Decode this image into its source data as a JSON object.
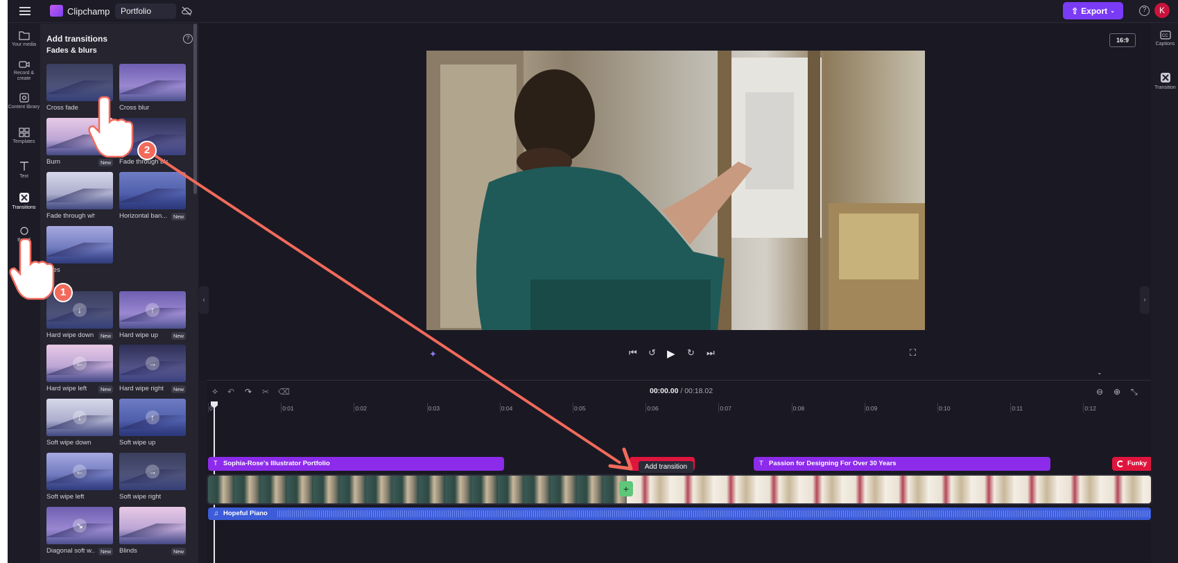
{
  "app": {
    "name": "Clipchamp",
    "project_name": "Portfolio",
    "export_label": "Export",
    "avatar_initial": "K",
    "accent_color": "#7a3bf5"
  },
  "left_rail": {
    "items": [
      {
        "label": "Your media",
        "icon": "folder-icon"
      },
      {
        "label": "Record & create",
        "icon": "camera-icon"
      },
      {
        "label": "Content library",
        "icon": "library-icon"
      },
      {
        "label": "Templates",
        "icon": "templates-icon"
      },
      {
        "label": "Text",
        "icon": "text-icon"
      },
      {
        "label": "Transitions",
        "icon": "transitions-icon",
        "active": true
      },
      {
        "label": "Brand",
        "icon": "brand-icon"
      }
    ]
  },
  "panel": {
    "title": "Add transitions",
    "section": "Fades & blurs",
    "tiles": [
      {
        "label": "Cross fade",
        "new": false
      },
      {
        "label": "Cross blur",
        "new": false
      },
      {
        "label": "Burn",
        "new": true
      },
      {
        "label": "Fade through black",
        "new": false
      },
      {
        "label": "Fade through white",
        "new": false
      },
      {
        "label": "Horizontal ban...",
        "new": true
      },
      {
        "label": "Tiles",
        "new": false
      },
      {
        "label": "Hard wipe down",
        "new": true,
        "arrow": "↓"
      },
      {
        "label": "Hard wipe up",
        "new": true,
        "arrow": "↑"
      },
      {
        "label": "Hard wipe left",
        "new": true,
        "arrow": "←"
      },
      {
        "label": "Hard wipe right",
        "new": true,
        "arrow": "→"
      },
      {
        "label": "Soft wipe down",
        "new": false,
        "arrow": "↓"
      },
      {
        "label": "Soft wipe up",
        "new": false,
        "arrow": "↑"
      },
      {
        "label": "Soft wipe left",
        "new": false,
        "arrow": "←"
      },
      {
        "label": "Soft wipe right",
        "new": false,
        "arrow": "→"
      },
      {
        "label": "Diagonal soft w...",
        "new": true,
        "arrow": "↘"
      },
      {
        "label": "Blinds",
        "new": true
      }
    ],
    "new_badge": "New"
  },
  "preview": {
    "aspect_ratio": "16:9"
  },
  "right_rail": {
    "items": [
      {
        "label": "Captions",
        "icon": "captions-icon"
      },
      {
        "label": "Transition",
        "icon": "transition-icon"
      }
    ]
  },
  "timeline": {
    "current_time": "00:00.00",
    "total_time": " / 00:18.02",
    "ticks": [
      "0",
      "0:01",
      "0:02",
      "0:03",
      "0:04",
      "0:05",
      "0:06",
      "0:07",
      "0:08",
      "0:09",
      "0:10",
      "0:11",
      "0:12"
    ],
    "text_clips": [
      {
        "label": "Sophia-Rose's Illustrator Portfolio"
      },
      {
        "label": "Passion for Designing For Over 30 Years"
      }
    ],
    "funky_label": "Funky",
    "tooltip": "Add transition",
    "audio_label": "Hopeful Piano"
  },
  "annotations": {
    "step1": "1",
    "step2": "2",
    "arrow_color": "#f26a5b"
  }
}
